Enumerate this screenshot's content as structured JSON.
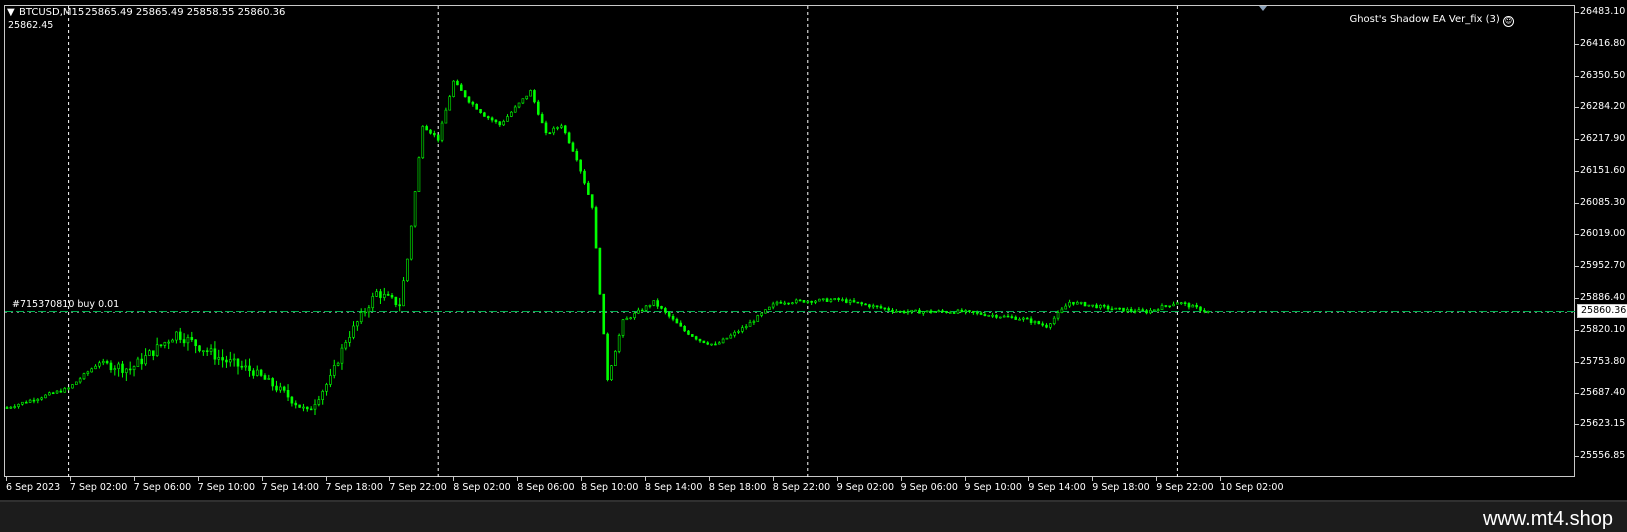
{
  "chart_header": {
    "collapse_arrow": "▼",
    "symbol_info": "BTCUSD,M15",
    "ohlc": "25865.49 25865.49 25858.55 25860.36",
    "sub_value": "25862.45"
  },
  "ea": {
    "label": "Ghost's Shadow EA Ver_fix (3)",
    "face_icon": "smiley-icon"
  },
  "order_line": {
    "label": "#715370810 buy 0.01",
    "price": 25860.36
  },
  "bid_label": "25860.36",
  "colors": {
    "background": "#000000",
    "candle": "#00ff00",
    "grid": "#ffffff",
    "order_line": "#00b050",
    "axis_text": "#ffffff"
  },
  "price_axis": [
    "26483.10",
    "26416.80",
    "26350.50",
    "26284.20",
    "26217.90",
    "26151.60",
    "26085.30",
    "26019.00",
    "25952.70",
    "25886.40",
    "25820.10",
    "25753.80",
    "25687.40",
    "25623.15",
    "25556.85"
  ],
  "time_axis": [
    "6 Sep 2023",
    "7 Sep 02:00",
    "7 Sep 06:00",
    "7 Sep 10:00",
    "7 Sep 14:00",
    "7 Sep 18:00",
    "7 Sep 22:00",
    "8 Sep 02:00",
    "8 Sep 06:00",
    "8 Sep 10:00",
    "8 Sep 14:00",
    "8 Sep 18:00",
    "8 Sep 22:00",
    "9 Sep 02:00",
    "9 Sep 06:00",
    "9 Sep 10:00",
    "9 Sep 14:00",
    "9 Sep 18:00",
    "9 Sep 22:00",
    "10 Sep 02:00"
  ],
  "chart_data": {
    "type": "candlestick",
    "symbol": "BTCUSD",
    "timeframe": "M15",
    "ylim": [
      25556.85,
      26483.1
    ],
    "period_separators": [
      "7 Sep 00:00",
      "8 Sep 00:00",
      "9 Sep 00:00",
      "10 Sep 00:00"
    ],
    "keypoints": [
      {
        "t": "6 Sep 20:00",
        "price": 25660
      },
      {
        "t": "7 Sep 00:00",
        "price": 25700
      },
      {
        "t": "7 Sep 02:00",
        "price": 25755
      },
      {
        "t": "7 Sep 04:00",
        "price": 25740
      },
      {
        "t": "7 Sep 06:00",
        "price": 25790
      },
      {
        "t": "7 Sep 07:00",
        "price": 25815
      },
      {
        "t": "7 Sep 10:00",
        "price": 25760
      },
      {
        "t": "7 Sep 12:00",
        "price": 25735
      },
      {
        "t": "7 Sep 14:00",
        "price": 25690
      },
      {
        "t": "7 Sep 15:30",
        "price": 25650
      },
      {
        "t": "7 Sep 17:00",
        "price": 25720
      },
      {
        "t": "7 Sep 18:00",
        "price": 25800
      },
      {
        "t": "7 Sep 20:00",
        "price": 25900
      },
      {
        "t": "7 Sep 21:30",
        "price": 25875
      },
      {
        "t": "7 Sep 22:00",
        "price": 25970
      },
      {
        "t": "7 Sep 23:00",
        "price": 26250
      },
      {
        "t": "8 Sep 00:00",
        "price": 26220
      },
      {
        "t": "8 Sep 01:00",
        "price": 26340
      },
      {
        "t": "8 Sep 02:00",
        "price": 26300
      },
      {
        "t": "8 Sep 03:00",
        "price": 26270
      },
      {
        "t": "8 Sep 04:00",
        "price": 26250
      },
      {
        "t": "8 Sep 06:00",
        "price": 26320
      },
      {
        "t": "8 Sep 07:00",
        "price": 26230
      },
      {
        "t": "8 Sep 08:00",
        "price": 26250
      },
      {
        "t": "8 Sep 09:00",
        "price": 26180
      },
      {
        "t": "8 Sep 10:00",
        "price": 26080
      },
      {
        "t": "8 Sep 11:00",
        "price": 25720
      },
      {
        "t": "8 Sep 12:00",
        "price": 25840
      },
      {
        "t": "8 Sep 13:00",
        "price": 25860
      },
      {
        "t": "8 Sep 14:00",
        "price": 25880
      },
      {
        "t": "8 Sep 16:00",
        "price": 25820
      },
      {
        "t": "8 Sep 17:00",
        "price": 25800
      },
      {
        "t": "8 Sep 18:00",
        "price": 25790
      },
      {
        "t": "8 Sep 20:00",
        "price": 25830
      },
      {
        "t": "8 Sep 22:00",
        "price": 25880
      },
      {
        "t": "9 Sep 02:00",
        "price": 25885
      },
      {
        "t": "9 Sep 06:00",
        "price": 25860
      },
      {
        "t": "9 Sep 10:00",
        "price": 25860
      },
      {
        "t": "9 Sep 14:00",
        "price": 25845
      },
      {
        "t": "9 Sep 15:30",
        "price": 25830
      },
      {
        "t": "9 Sep 17:00",
        "price": 25880
      },
      {
        "t": "9 Sep 20:00",
        "price": 25865
      },
      {
        "t": "9 Sep 22:00",
        "price": 25860
      },
      {
        "t": "10 Sep 00:00",
        "price": 25880
      },
      {
        "t": "10 Sep 01:00",
        "price": 25870
      },
      {
        "t": "10 Sep 02:00",
        "price": 25860
      }
    ]
  },
  "footer": {
    "watermark": "www.mt4.shop"
  }
}
